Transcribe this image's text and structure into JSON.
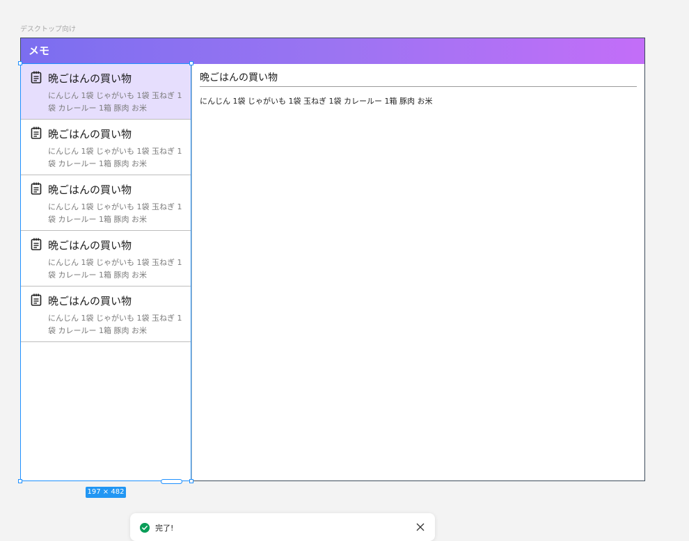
{
  "frame_label": "デスクトップ向け",
  "app": {
    "title": "メモ",
    "header_gradient": [
      "#7b6ef0",
      "#c36ef8"
    ],
    "selected_color": "#e6defd"
  },
  "memos": [
    {
      "title": "晩ごはんの買い物",
      "preview": "にんじん 1袋 じゃがいも 1袋 玉ねぎ 1袋 カレールー 1箱 豚肉 お米",
      "icon": "notepad-icon",
      "selected": true
    },
    {
      "title": "晩ごはんの買い物",
      "preview": "にんじん 1袋 じゃがいも 1袋 玉ねぎ 1袋 カレールー 1箱 豚肉 お米",
      "icon": "notepad-icon",
      "selected": false
    },
    {
      "title": "晩ごはんの買い物",
      "preview": "にんじん 1袋 じゃがいも 1袋 玉ねぎ 1袋 カレールー 1箱 豚肉 お米",
      "icon": "notepad-icon",
      "selected": false
    },
    {
      "title": "晩ごはんの買い物",
      "preview": "にんじん 1袋 じゃがいも 1袋 玉ねぎ 1袋 カレールー 1箱 豚肉 お米",
      "icon": "notepad-icon",
      "selected": false
    },
    {
      "title": "晩ごはんの買い物",
      "preview": "にんじん 1袋 じゃがいも 1袋 玉ねぎ 1袋 カレールー 1箱 豚肉 お米",
      "icon": "notepad-icon",
      "selected": false
    }
  ],
  "detail": {
    "title": "晩ごはんの買い物",
    "body": "にんじん 1袋 じゃがいも 1袋 玉ねぎ 1袋 カレールー 1箱 豚肉 お米"
  },
  "selection": {
    "size_label": "197 × 482",
    "color": "#1e90ff"
  },
  "toast": {
    "message": "完了!",
    "status_color": "#0a9d58",
    "icons": [
      "check-circle-icon",
      "close-icon"
    ]
  }
}
